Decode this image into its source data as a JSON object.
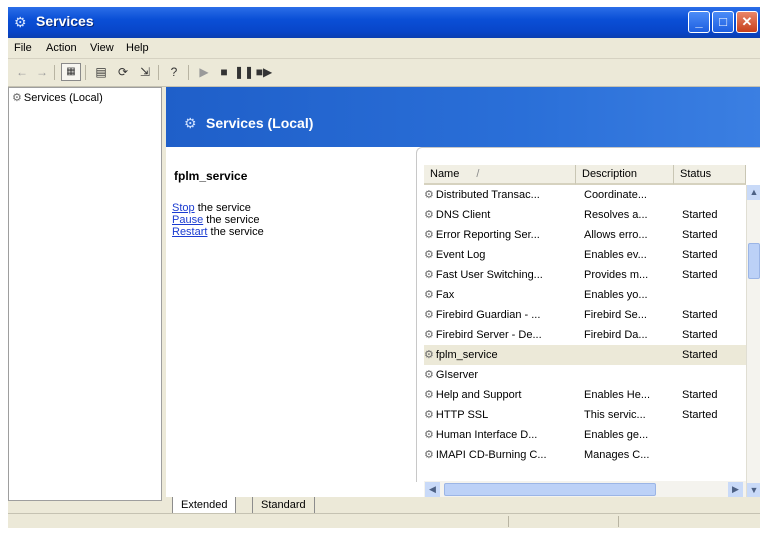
{
  "window": {
    "title": "Services",
    "icon": "gear-icon"
  },
  "title_buttons": {
    "minimize": "_",
    "maximize": "□",
    "close": "✕"
  },
  "menu": [
    "File",
    "Action",
    "View",
    "Help"
  ],
  "toolbar": {
    "icons": [
      "back-arrow-icon",
      "forward-arrow-icon",
      "show-hide-tree-icon",
      "properties-icon",
      "refresh-icon",
      "export-list-icon",
      "help-icon",
      "start-service-icon",
      "stop-service-icon",
      "pause-service-icon",
      "restart-service-icon"
    ]
  },
  "tree": {
    "root_label": "Services (Local)"
  },
  "header": {
    "title": "Services (Local)"
  },
  "description": {
    "service_name": "fplm_service",
    "actions": [
      {
        "link": "Stop",
        "rest": " the service"
      },
      {
        "link": "Pause",
        "rest": " the service"
      },
      {
        "link": "Restart",
        "rest": " the service"
      }
    ]
  },
  "table": {
    "columns": [
      "Name",
      "Description",
      "Status"
    ],
    "sort_indicator": "/",
    "rows": [
      {
        "name": "Distributed Transac...",
        "description": "Coordinate...",
        "status": ""
      },
      {
        "name": "DNS Client",
        "description": "Resolves a...",
        "status": "Started"
      },
      {
        "name": "Error Reporting Ser...",
        "description": "Allows erro...",
        "status": "Started"
      },
      {
        "name": "Event Log",
        "description": "Enables ev...",
        "status": "Started"
      },
      {
        "name": "Fast User Switching...",
        "description": "Provides m...",
        "status": "Started"
      },
      {
        "name": "Fax",
        "description": "Enables yo...",
        "status": ""
      },
      {
        "name": "Firebird Guardian - ...",
        "description": "Firebird Se...",
        "status": "Started"
      },
      {
        "name": "Firebird Server - De...",
        "description": "Firebird Da...",
        "status": "Started"
      },
      {
        "name": "fplm_service",
        "description": "",
        "status": "Started",
        "selected": true
      },
      {
        "name": "GIserver",
        "description": "",
        "status": ""
      },
      {
        "name": "Help and Support",
        "description": "Enables He...",
        "status": "Started"
      },
      {
        "name": "HTTP SSL",
        "description": "This servic...",
        "status": "Started"
      },
      {
        "name": "Human Interface D...",
        "description": "Enables ge...",
        "status": ""
      },
      {
        "name": "IMAPI CD-Burning C...",
        "description": "Manages C...",
        "status": ""
      }
    ]
  },
  "tabs": [
    "Extended",
    "Standard"
  ],
  "active_tab": "Extended"
}
